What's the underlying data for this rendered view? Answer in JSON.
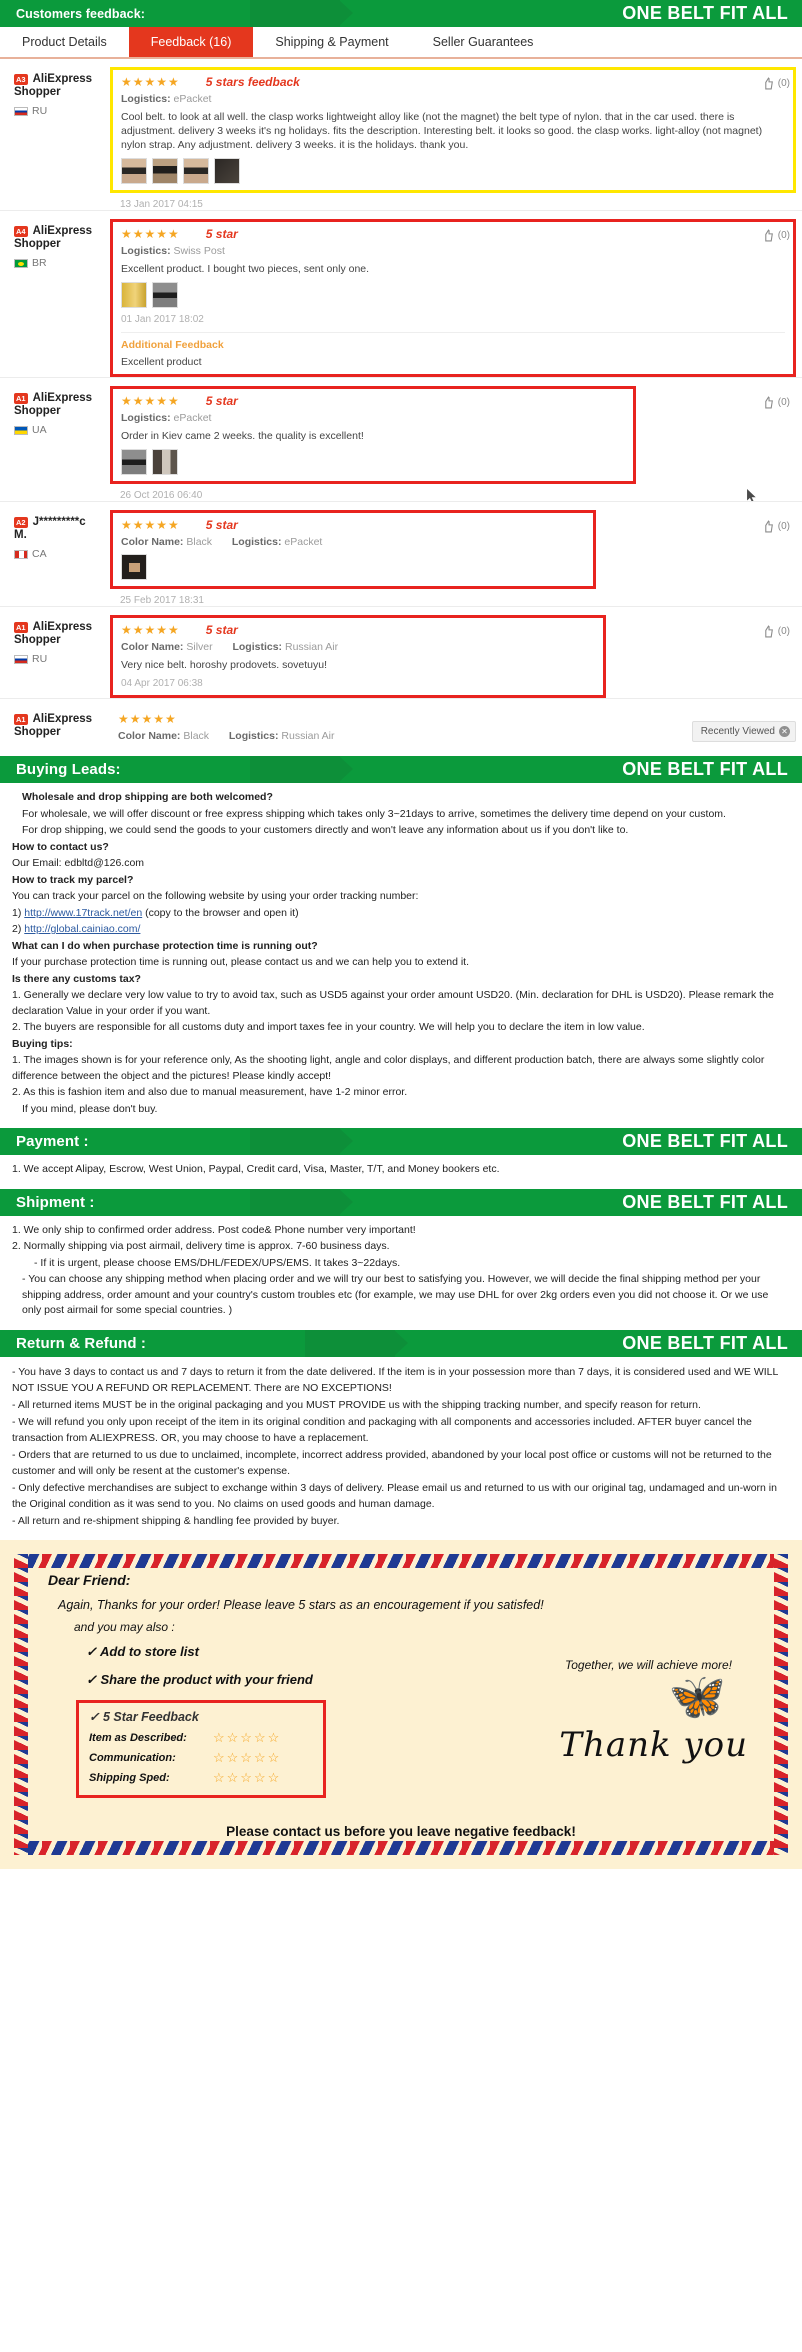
{
  "banners": {
    "feedback": {
      "left": "Customers feedback:",
      "right": "ONE BELT FIT ALL"
    },
    "buying_leads": {
      "left": "Buying Leads:",
      "right": "ONE BELT FIT ALL"
    },
    "payment": {
      "left": "Payment :",
      "right": "ONE BELT FIT ALL"
    },
    "shipment": {
      "left": "Shipment :",
      "right": "ONE BELT FIT ALL"
    },
    "return": {
      "left": "Return & Refund :",
      "right": "ONE BELT FIT ALL"
    }
  },
  "tabs": [
    {
      "label": "Product Details",
      "active": false
    },
    {
      "label": "Feedback (16)",
      "active": true
    },
    {
      "label": "Shipping & Payment",
      "active": false
    },
    {
      "label": "Seller Guarantees",
      "active": false
    }
  ],
  "feedback": [
    {
      "badge": "A3",
      "user_line1": "AliExpress",
      "user_line2": "Shopper",
      "country": "RU",
      "flag": "flag-ru",
      "stars": "★★★★★",
      "star_note": "5 stars feedback",
      "logistics_label": "Logistics:",
      "logistics_value": "ePacket",
      "color_label": "",
      "color_value": "",
      "text": "Cool belt. to look at all well. the clasp works lightweight alloy like (not the magnet) the belt type of nylon. that in the car used. there is adjustment. delivery 3 weeks it's ng holidays. fits the description. Interesting belt. it looks so good. the clasp works. light-alloy (not magnet) nylon strap. Any adjustment. delivery 3 weeks. it is the holidays. thank you.",
      "thumbs": [
        "t-belt",
        "t-belt2",
        "t-belt",
        "t-dark"
      ],
      "date": "13 Jan 2017 04:15",
      "likes": "(0)",
      "highlight": "yellow",
      "additional": null
    },
    {
      "badge": "A4",
      "user_line1": "AliExpress",
      "user_line2": "Shopper",
      "country": "BR",
      "flag": "flag-br",
      "stars": "★★★★★",
      "star_note": "5 star",
      "logistics_label": "Logistics:",
      "logistics_value": "Swiss Post",
      "color_label": "",
      "color_value": "",
      "text": "Excellent product. I bought two pieces, sent only one.",
      "thumbs": [
        "t-yellow",
        "t-gray"
      ],
      "date": "01 Jan 2017 18:02",
      "likes": "(0)",
      "highlight": "red",
      "additional": {
        "title": "Additional Feedback",
        "text": "Excellent product"
      }
    },
    {
      "badge": "A1",
      "user_line1": "AliExpress",
      "user_line2": "Shopper",
      "country": "UA",
      "flag": "flag-ua",
      "stars": "★★★★★",
      "star_note": "5 star",
      "logistics_label": "Logistics:",
      "logistics_value": "ePacket",
      "color_label": "",
      "color_value": "",
      "text": "Order in Kiev came 2 weeks. the quality is excellent!",
      "thumbs": [
        "t-gray",
        "t-room"
      ],
      "date": "26 Oct 2016 06:40",
      "likes": "(0)",
      "highlight": "red",
      "additional": null
    },
    {
      "badge": "A2",
      "user_line1": "J*********c",
      "user_line2": "M.",
      "country": "CA",
      "flag": "flag-ca",
      "stars": "★★★★★",
      "star_note": "5 star",
      "logistics_label": "Logistics:",
      "logistics_value": "ePacket",
      "color_label": "Color Name:",
      "color_value": "Black",
      "text": "",
      "thumbs": [
        "t-buckle"
      ],
      "date": "25 Feb 2017 18:31",
      "likes": "(0)",
      "highlight": "red",
      "additional": null
    },
    {
      "badge": "A1",
      "user_line1": "AliExpress",
      "user_line2": "Shopper",
      "country": "RU",
      "flag": "flag-ru",
      "stars": "★★★★★",
      "star_note": "5 star",
      "logistics_label": "Logistics:",
      "logistics_value": "Russian Air",
      "color_label": "Color Name:",
      "color_value": "Silver",
      "text": "Very nice belt. horoshy prodovets. sovetuyu!",
      "thumbs": [],
      "date": "04 Apr 2017 06:38",
      "likes": "(0)",
      "highlight": "red",
      "additional": null
    },
    {
      "badge": "A1",
      "user_line1": "AliExpress",
      "user_line2": "Shopper",
      "country": "",
      "flag": "",
      "stars": "★★★★★",
      "star_note": "",
      "logistics_label": "Logistics:",
      "logistics_value": "Russian Air",
      "color_label": "Color Name:",
      "color_value": "Black",
      "text": "",
      "thumbs": [],
      "date": "",
      "likes": "",
      "highlight": "none",
      "additional": null
    }
  ],
  "recently_viewed": "Recently Viewed",
  "buying_leads": {
    "q1": "Wholesale and drop shipping are both welcomed?",
    "a1": "For wholesale, we will offer discount or free express shipping which takes only 3~21days to arrive, sometimes the delivery time depend on your custom.",
    "a1b": "For drop shipping, we could send the goods to your customers directly and won't leave any information about us if you don't like to.",
    "q2": "How to contact us?",
    "a2": "Our Email: edbltd@126.com",
    "q3": "How to track my parcel?",
    "a3": "You can track your parcel on the following website by using your order tracking number:",
    "a3_link1_num": "1)",
    "a3_link1": "http://www.17track.net/en",
    "a3_link1_note": "(copy to the browser and open it)",
    "a3_link2_num": "2)",
    "a3_link2": "http://global.cainiao.com/",
    "q4": "What can I do when purchase protection time is running out?",
    "a4": "If your purchase protection time is running out, please contact us and we can help you to extend it.",
    "q5": "Is there any customs tax?",
    "a5_1": "1. Generally we declare very low value to try to avoid tax, such as USD5 against your order amount USD20. (Min. declaration for DHL is USD20). Please remark the declaration Value in your order if you want.",
    "a5_2": "2. The buyers are responsible for all customs duty and import taxes fee in your country. We will help you to declare the item in low value.",
    "q6": "Buying tips:",
    "a6_1": "1. The images shown is for your reference only, As the shooting light, angle and color displays, and different production batch, there are always some slightly color difference between the object and the pictures! Please kindly accept!",
    "a6_2": "2. As this is fashion item and also due to manual measurement, have 1-2 minor error.",
    "a6_3": "If you mind, please don't buy."
  },
  "payment": {
    "line1": "1. We accept Alipay, Escrow, West Union, Paypal, Credit card, Visa, Master, T/T, and Money bookers etc."
  },
  "shipment": {
    "line1": "1. We only ship to confirmed order address. Post code& Phone number very important!",
    "line2": "2. Normally shipping via post airmail, delivery time is approx. 7-60 business days.",
    "line3": "- If it is urgent, please choose EMS/DHL/FEDEX/UPS/EMS. It takes 3~22days.",
    "line4": "- You can choose any shipping method when placing order and we will try our best to satisfying you. However, we will decide the final shipping method per your shipping address, order amount and your country's custom troubles etc (for example, we may use DHL for over 2kg orders even you did not choose it. Or we use only post airmail for some special countries. )"
  },
  "refund": {
    "line1": "- You have 3 days to contact us and 7 days to return it from the date delivered. If the item is in your possession more than 7 days, it is considered used and WE WILL NOT ISSUE YOU A REFUND OR REPLACEMENT. There are NO EXCEPTIONS!",
    "line2": "- All returned items MUST be in the original packaging and you MUST PROVIDE us with the shipping tracking number, and specify reason for return.",
    "line3": "- We will refund you only upon receipt of the item in its original condition and packaging with all components and accessories included. AFTER buyer cancel the transaction from ALIEXPRESS. OR, you may choose to have a replacement.",
    "line4": "- Orders that are returned to us due to unclaimed, incomplete, incorrect address provided, abandoned by your local post office or customs will not be returned to the customer and will only be resent at the customer's expense.",
    "line5": "- Only defective merchandises are subject to exchange within 3 days of delivery. Please email us and returned to us with our original tag, undamaged and un-worn in the Original condition as it was send to you. No claims on used goods and human damage.",
    "line6": "- All return and re-shipment shipping & handling fee provided by buyer."
  },
  "thankyou": {
    "dear": "Dear Friend:",
    "again": "Again, Thanks for your order! Please leave 5 stars as an encouragement if you satisfed!",
    "also": "and you may also :",
    "item1": "✓ Add to store list",
    "item2": "✓ Share the product with your friend",
    "item3": "✓ 5 Star Feedback",
    "together": "Together, we will achieve more!",
    "ratings": [
      {
        "label": "Item as Described:",
        "stars": "☆☆☆☆☆"
      },
      {
        "label": "Communication:",
        "stars": "☆☆☆☆☆"
      },
      {
        "label": "Shipping Sped:",
        "stars": "☆☆☆☆☆"
      }
    ],
    "thank_you_script": "Thank you",
    "contact": "Please contact us before you leave negative feedback!"
  }
}
